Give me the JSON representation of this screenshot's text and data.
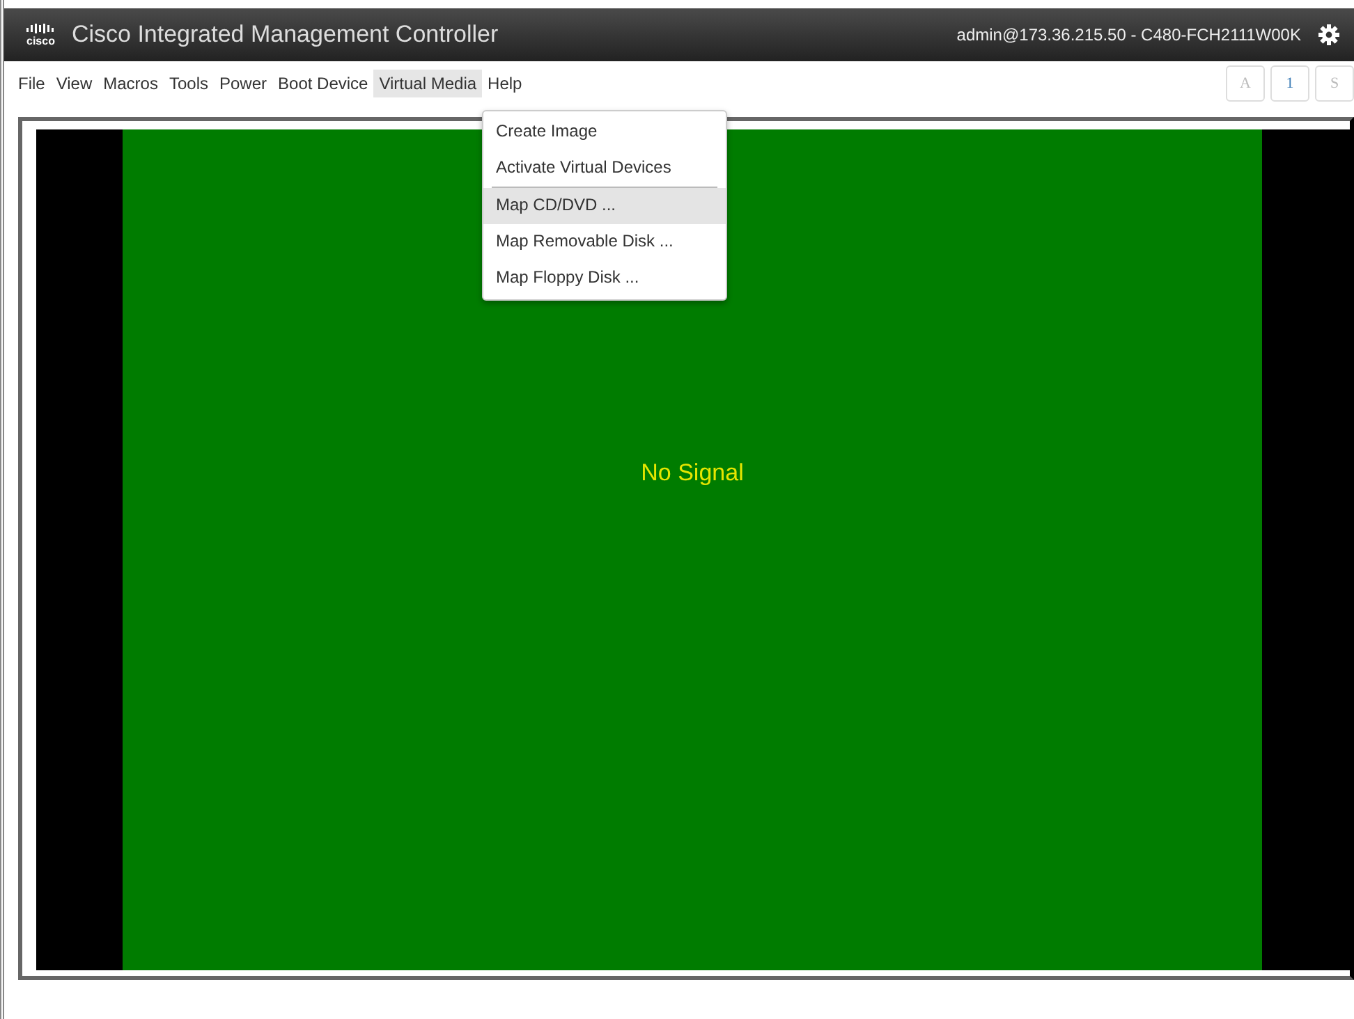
{
  "header": {
    "logo": "cisco",
    "title": "Cisco Integrated Management Controller",
    "user": "admin@173.36.215.50 - C480-FCH2111W00K"
  },
  "menu": [
    {
      "label": "File",
      "selected": false
    },
    {
      "label": "View",
      "selected": false
    },
    {
      "label": "Macros",
      "selected": false
    },
    {
      "label": "Tools",
      "selected": false
    },
    {
      "label": "Power",
      "selected": false
    },
    {
      "label": "Boot Device",
      "selected": false
    },
    {
      "label": "Virtual Media",
      "selected": true
    },
    {
      "label": "Help",
      "selected": false
    }
  ],
  "toolbar_buttons": [
    {
      "label": "A",
      "selected": false
    },
    {
      "label": "1",
      "selected": true
    },
    {
      "label": "S",
      "selected": false
    }
  ],
  "dropdown": [
    {
      "label": "Create Image",
      "selected": false,
      "divider_after": false
    },
    {
      "label": "Activate Virtual Devices",
      "selected": false,
      "divider_after": true
    },
    {
      "label": "Map CD/DVD ...",
      "selected": true,
      "divider_after": false
    },
    {
      "label": "Map Removable Disk ...",
      "selected": false,
      "divider_after": false
    },
    {
      "label": "Map Floppy Disk ...",
      "selected": false,
      "divider_after": false
    }
  ],
  "screen": {
    "message": "No Signal"
  }
}
